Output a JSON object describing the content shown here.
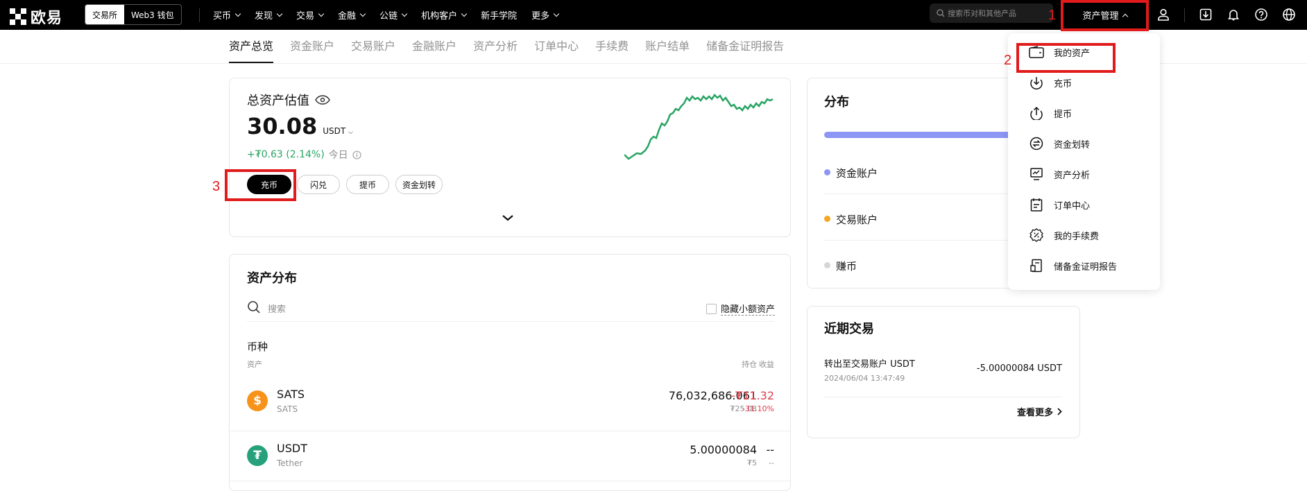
{
  "topbar": {
    "logo_text": "欧易",
    "seg_exchange": "交易所",
    "seg_web3": "Web3 钱包",
    "nav": [
      "买币",
      "发现",
      "交易",
      "金融",
      "公链",
      "机构客户",
      "新手学院",
      "更多"
    ],
    "nav_has_chev": [
      true,
      true,
      true,
      true,
      true,
      true,
      false,
      true
    ],
    "search_placeholder": "搜索币对和其他产品",
    "asset_mgmt": "资产管理"
  },
  "subnav": [
    "资产总览",
    "资金账户",
    "交易账户",
    "金融账户",
    "资产分析",
    "订单中心",
    "手续费",
    "账户结单",
    "储备金证明报告"
  ],
  "overview": {
    "title": "总资产估值",
    "value": "30.08",
    "unit": "USDT",
    "change": "+₮0.63 (2.14%)",
    "period": "今日",
    "buttons": [
      "充币",
      "闪兑",
      "提币",
      "资金划转"
    ]
  },
  "distribution": {
    "title": "资产分布",
    "search_placeholder": "搜索",
    "hide_small": "隐藏小额资产",
    "section": "币种",
    "col_asset": "资产",
    "col_hold": "持仓",
    "col_pnl": "收益",
    "rows": [
      {
        "symbol": "SATS",
        "name": "SATS",
        "hold": "76,032,686.061",
        "hold_val": "₮25.08",
        "pnl": "-₮11.32",
        "pnl_pct": "-31.10%"
      },
      {
        "symbol": "USDT",
        "name": "Tether",
        "hold": "5.00000084",
        "hold_val": "₮5",
        "pnl": "--",
        "pnl_pct": "--"
      }
    ]
  },
  "split": {
    "title": "分布",
    "items": [
      "资金账户",
      "交易账户",
      "赚币"
    ],
    "colors": [
      "#8d95f5",
      "#f5a623",
      "#d6d6d6"
    ]
  },
  "recent": {
    "title": "近期交易",
    "tx_desc": "转出至交易账户 USDT",
    "tx_time": "2024/06/04 13:47:49",
    "tx_amount": "-5.00000084 USDT",
    "more": "查看更多"
  },
  "dropdown": [
    "我的资产",
    "充币",
    "提币",
    "资金划转",
    "资产分析",
    "订单中心",
    "我的手续费",
    "储备金证明报告"
  ],
  "annotations": [
    "1",
    "2",
    "3"
  ],
  "colors": {
    "accent_red": "#e11b1b",
    "green": "#27a463",
    "loss_red": "#e03e4c"
  }
}
